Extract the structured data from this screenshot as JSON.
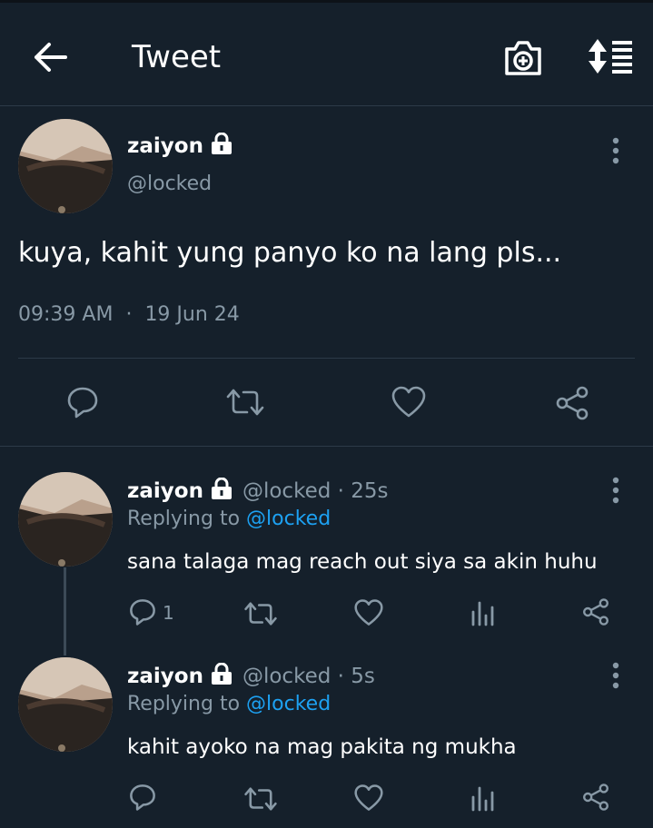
{
  "header": {
    "title": "Tweet"
  },
  "icons": {
    "back": "arrow-left-icon",
    "camera": "camera-add-icon",
    "sort": "sort-expand-icon",
    "lock": "lock-icon",
    "more": "more-vertical-icon",
    "reply": "reply-icon",
    "retweet": "retweet-icon",
    "like": "heart-icon",
    "share": "share-icon",
    "analytics": "analytics-icon"
  },
  "colors": {
    "background": "#15202b",
    "accent": "#1da1f2",
    "muted": "#8899a6",
    "divider": "#2c3a48"
  },
  "main_tweet": {
    "name": "zaiyon",
    "handle": "@locked",
    "text": "kuya, kahit yung panyo ko na lang pls...",
    "time": "09:39 AM",
    "separator": "·",
    "date": "19 Jun 24"
  },
  "replies": [
    {
      "name": "zaiyon",
      "handle_time": "@locked · 25s",
      "replying_label": "Replying to",
      "replying_to": "@locked",
      "text": "sana talaga mag reach out siya sa akin huhu",
      "reply_count": "1"
    },
    {
      "name": "zaiyon",
      "handle_time": "@locked · 5s",
      "replying_label": "Replying to",
      "replying_to": "@locked",
      "text": "kahit ayoko na mag pakita ng mukha",
      "reply_count": ""
    }
  ]
}
